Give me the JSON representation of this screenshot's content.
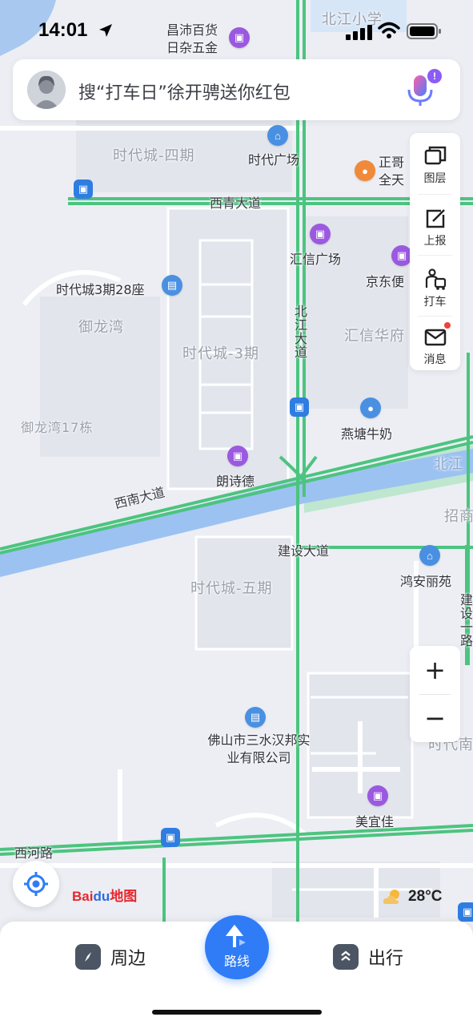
{
  "status_bar": {
    "time": "14:01"
  },
  "search": {
    "placeholder": "搜“打车日”徐开骋送你红包",
    "voice_badge": "!"
  },
  "tools": [
    {
      "label": "图层",
      "icon": "layers-icon"
    },
    {
      "label": "上报",
      "icon": "report-edit-icon"
    },
    {
      "label": "打车",
      "icon": "taxi-icon"
    },
    {
      "label": "消息",
      "icon": "message-icon"
    }
  ],
  "zoom": {
    "in": "+",
    "out": "−"
  },
  "logo": {
    "text_a": "Bai",
    "text_b": "du",
    "text_c": "地图"
  },
  "weather": {
    "temp": "28°C",
    "icon": "partly-cloudy-icon"
  },
  "bottom_nav": {
    "nearby": "周边",
    "route": "路线",
    "travel": "出行"
  },
  "map": {
    "areas": [
      "时代城-四期",
      "御龙湾",
      "时代城-3期",
      "时代城-五期",
      "汇信华府",
      "北江小学",
      "招商",
      "时代南",
      "御龙湾17栋"
    ],
    "roads": [
      "西青大道",
      "北江大道",
      "西南大道",
      "建设大道",
      "西河路",
      "建设一路",
      "北江"
    ],
    "pois": [
      "昌沛百货日杂五金",
      "时代广场",
      "正哥全天",
      "汇信广场",
      "京东便",
      "时代城3期28座",
      "燕塘牛奶",
      "朗诗德",
      "鸿安丽苑",
      "佛山市三水汉邦实业有限公司",
      "美宜佳"
    ]
  }
}
